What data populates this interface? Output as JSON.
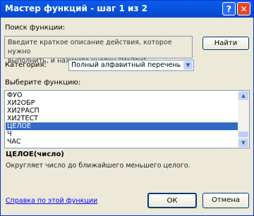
{
  "window": {
    "title": "Мастер функций - шаг 1 из 2",
    "help_glyph": "?",
    "close_glyph": "✕"
  },
  "search": {
    "label": "Поиск функции:",
    "description_lines": [
      "Введите краткое описание действия, которое нужно",
      "выполнить, и нажмите кнопку \"Найти\""
    ],
    "find_button": "Найти"
  },
  "category": {
    "label": "Категория:",
    "selected": "Полный алфавитный перечень"
  },
  "functions": {
    "label": "Выберите функцию:",
    "items": [
      "ФУО",
      "ХИ2ОБР",
      "ХИ2РАСП",
      "ХИ2ТЕСТ",
      "ЦЕЛОЕ",
      "Ч",
      "ЧАС"
    ],
    "selected": "ЦЕЛОЕ"
  },
  "selected_function": {
    "signature": "ЦЕЛОЕ(число)",
    "description": "Округляет число до ближайшего меньшего целого."
  },
  "footer": {
    "help_link": "Справка по этой функции",
    "ok_button": "ОК",
    "cancel_button": "Отмена"
  },
  "colors": {
    "titlebar": "#0854e3",
    "selection": "#316ac5",
    "link": "#0000ff"
  }
}
